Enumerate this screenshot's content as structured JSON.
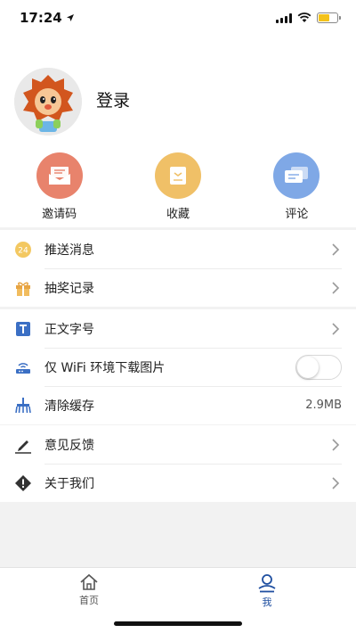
{
  "status_bar": {
    "time": "17:24",
    "location_icon": "location-arrow-icon",
    "battery_color": "#f4c21a"
  },
  "profile": {
    "login_label": "登录",
    "avatar_icon": "lion-cartoon-avatar"
  },
  "quick_actions": [
    {
      "label": "邀请码",
      "icon": "envelope-icon",
      "color": "#e8836c"
    },
    {
      "label": "收藏",
      "icon": "bookmark-icon",
      "color": "#f0c067"
    },
    {
      "label": "评论",
      "icon": "comment-icon",
      "color": "#7fa8e6"
    }
  ],
  "menu": {
    "push": {
      "label": "推送消息",
      "icon": "push-24-icon"
    },
    "lottery": {
      "label": "抽奖记录",
      "icon": "gift-icon"
    },
    "font_size": {
      "label": "正文字号",
      "icon": "text-t-icon"
    },
    "wifi_images": {
      "label": "仅 WiFi 环境下载图片",
      "icon": "router-icon",
      "toggle_on": false
    },
    "clear_cache": {
      "label": "清除缓存",
      "value": "2.9MB",
      "icon": "broom-icon"
    },
    "feedback": {
      "label": "意见反馈",
      "icon": "pencil-icon"
    },
    "about": {
      "label": "关于我们",
      "icon": "diamond-info-icon"
    }
  },
  "tabbar": {
    "home": {
      "label": "首页",
      "icon": "home-icon",
      "active": false
    },
    "me": {
      "label": "我",
      "icon": "person-icon",
      "active": true
    }
  },
  "colors": {
    "accent": "#1f4fa0",
    "inactive_tab": "#555555"
  }
}
